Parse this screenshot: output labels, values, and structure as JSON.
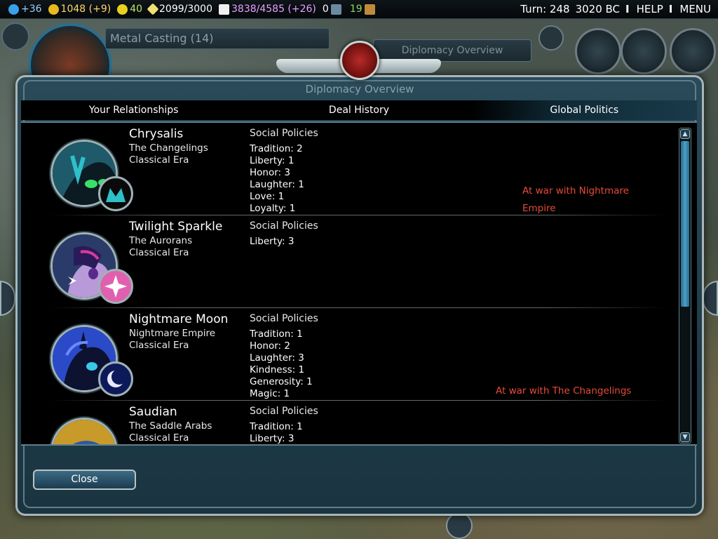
{
  "topbar": {
    "science": "+36",
    "gold": "1048 (+9)",
    "happiness": "40",
    "culture": "2099/3000",
    "faith": "3838/4585 (+26)",
    "tourism": "0",
    "spies": "19",
    "turn": "Turn: 248",
    "year": "3020 BC",
    "help": "HELP",
    "menu": "MENU",
    "separator": "I"
  },
  "hud": {
    "tech_label": "Metal Casting (14)",
    "diplo_tab": "Diplomacy Overview"
  },
  "dialog": {
    "title": "Diplomacy Overview",
    "tabs": [
      {
        "label": "Your Relationships"
      },
      {
        "label": "Deal History"
      },
      {
        "label": "Global Politics"
      }
    ],
    "close_label": "Close"
  },
  "civs": [
    {
      "leader": "Chrysalis",
      "civ": "The Changelings",
      "era": "Classical Era",
      "policies_header": "Social Policies",
      "policies": [
        "Tradition: 2",
        "Liberty: 1",
        "Honor: 3",
        "Laughter: 1",
        "Love: 1",
        "Loyalty: 1"
      ],
      "war_lines": [
        "At war with Nightmare",
        "Empire"
      ],
      "portrait_color": "#1f5a6a",
      "emblem_color": "#1a1a1a"
    },
    {
      "leader": "Twilight Sparkle",
      "civ": "The Aurorans",
      "era": "Classical Era",
      "policies_header": "Social Policies",
      "policies": [
        "Liberty: 3"
      ],
      "war_lines": [],
      "portrait_color": "#2a3b6a",
      "emblem_color": "#d85aa0"
    },
    {
      "leader": "Nightmare Moon",
      "civ": "Nightmare Empire",
      "era": "Classical Era",
      "policies_header": "Social Policies",
      "policies": [
        "Tradition: 1",
        "Honor: 2",
        "Laughter: 3",
        "Kindness: 1",
        "Generosity: 1",
        "Magic: 1"
      ],
      "war_lines": [
        "At war with The Changelings"
      ],
      "portrait_color": "#1a2a8a",
      "emblem_color": "#0c1a5a"
    },
    {
      "leader": "Saudian",
      "civ": "The Saddle Arabs",
      "era": "Classical Era",
      "policies_header": "Social Policies",
      "policies": [
        "Tradition: 1",
        "Liberty: 3"
      ],
      "war_lines": [],
      "portrait_color": "#c89a2a",
      "emblem_color": "#1a1a1a"
    }
  ],
  "colors": {
    "war_text": "#e84a3a",
    "accent": "#4aa0c8"
  }
}
